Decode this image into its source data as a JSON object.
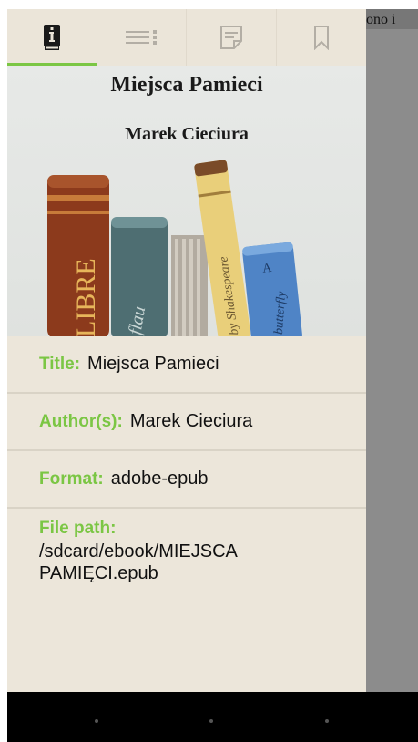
{
  "background": {
    "text": "ono i"
  },
  "tabs": [
    {
      "icon": "book-info-icon",
      "active": true
    },
    {
      "icon": "table-of-contents-icon",
      "active": false
    },
    {
      "icon": "notes-icon",
      "active": false
    },
    {
      "icon": "bookmark-icon",
      "active": false
    }
  ],
  "cover": {
    "title": "Miejsca Pamieci",
    "author": "Marek Cieciura",
    "spine_text": "LIBRE"
  },
  "info": {
    "title_label": "Title:",
    "title_value": "Miejsca Pamieci",
    "author_label": "Author(s):",
    "author_value": "Marek Cieciura",
    "format_label": "Format:",
    "format_value": "adobe-epub",
    "path_label": "File path:",
    "path_value": "/sdcard/ebook/MIEJSCA PAMIĘCI.epub"
  },
  "colors": {
    "accent": "#7bc644",
    "drawer": "#ece6da"
  }
}
